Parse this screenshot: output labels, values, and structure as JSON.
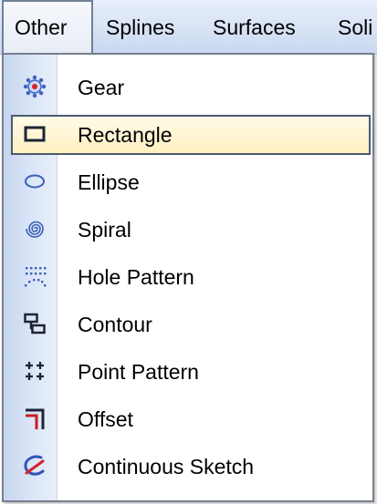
{
  "menubar": {
    "items": [
      {
        "label": "Other"
      },
      {
        "label": "Splines"
      },
      {
        "label": "Surfaces"
      },
      {
        "label": "Soli"
      }
    ]
  },
  "menu": {
    "items": [
      {
        "label": "Gear",
        "icon": "gear-icon"
      },
      {
        "label": "Rectangle",
        "icon": "rectangle-icon",
        "selected": true
      },
      {
        "label": "Ellipse",
        "icon": "ellipse-icon"
      },
      {
        "label": "Spiral",
        "icon": "spiral-icon"
      },
      {
        "label": "Hole Pattern",
        "icon": "hole-pattern-icon"
      },
      {
        "label": "Contour",
        "icon": "contour-icon"
      },
      {
        "label": "Point Pattern",
        "icon": "point-pattern-icon"
      },
      {
        "label": "Offset",
        "icon": "offset-icon"
      },
      {
        "label": "Continuous Sketch",
        "icon": "continuous-sketch-icon"
      }
    ]
  },
  "colors": {
    "menubar_bg": "#d8e3f5",
    "selection_bg": "#fff0c1",
    "selection_border": "#4b5a70",
    "gutter_bg": "#c5d5ef",
    "icon_dark": "#1d2436",
    "icon_red": "#c81e24",
    "icon_blue": "#2f55b6"
  }
}
